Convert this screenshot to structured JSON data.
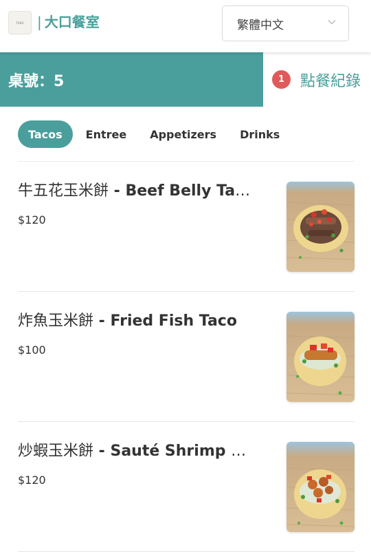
{
  "header": {
    "logo_text": "TAKO",
    "brand_separator": "|",
    "brand_name": "大口餐室",
    "language_select": {
      "selected": "繁體中文"
    }
  },
  "table_bar": {
    "table_label": "桌號：5",
    "order_count": "1",
    "order_history_label": "點餐紀錄"
  },
  "tabs": [
    {
      "label": "Tacos",
      "active": true
    },
    {
      "label": "Entree",
      "active": false
    },
    {
      "label": "Appetizers",
      "active": false
    },
    {
      "label": "Drinks",
      "active": false
    }
  ],
  "menu_items": [
    {
      "name_zh": "牛五花玉米餅",
      "name_sep": " - ",
      "name_en": "Beef Belly Taco",
      "price": "$120",
      "image": "beef-belly-taco-photo"
    },
    {
      "name_zh": "炸魚玉米餅",
      "name_sep": " - ",
      "name_en": "Fried Fish Taco",
      "price": "$100",
      "image": "fried-fish-taco-photo"
    },
    {
      "name_zh": "炒蝦玉米餅",
      "name_sep": " - ",
      "name_en": "Sauté Shrimp Taco",
      "price": "$120",
      "image": "saute-shrimp-taco-photo"
    }
  ],
  "colors": {
    "accent": "#4a9f9c",
    "badge": "#e05a5a",
    "text": "#333333"
  }
}
